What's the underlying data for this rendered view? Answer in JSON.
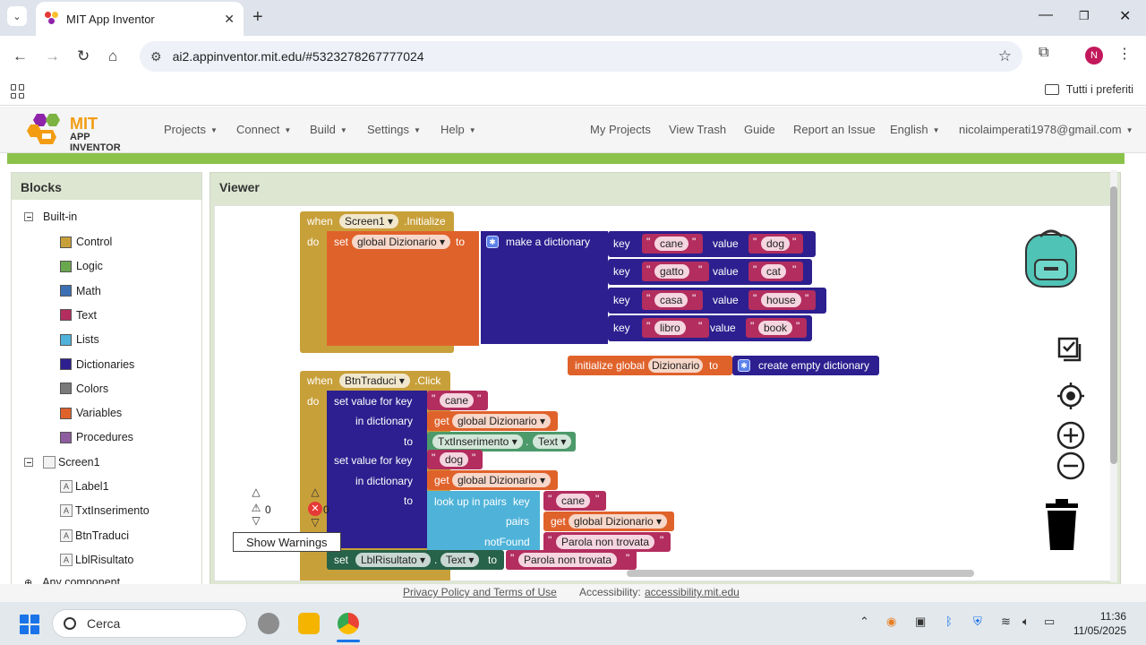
{
  "browser": {
    "tab_title": "MIT App Inventor",
    "url": "ai2.appinventor.mit.edu/#5323278267777024",
    "profile_initial": "N",
    "bookmarks_all_label": "Tutti i preferiti"
  },
  "app": {
    "logo_mit": "MIT",
    "logo_app_inventor": "APP INVENTOR",
    "menu": [
      "Projects",
      "Connect",
      "Build",
      "Settings",
      "Help"
    ],
    "right_links": [
      "My Projects",
      "View Trash",
      "Guide",
      "Report an Issue"
    ],
    "language": "English",
    "user_email": "nicolaimperati1978@gmail.com"
  },
  "blocks_panel": {
    "title": "Blocks",
    "builtin_label": "Built-in",
    "builtin_items": [
      {
        "label": "Control",
        "color": "#c8a03a"
      },
      {
        "label": "Logic",
        "color": "#6aa84f"
      },
      {
        "label": "Math",
        "color": "#3d6fb4"
      },
      {
        "label": "Text",
        "color": "#b32d5e"
      },
      {
        "label": "Lists",
        "color": "#4fb3d9"
      },
      {
        "label": "Dictionaries",
        "color": "#2d1f8f"
      },
      {
        "label": "Colors",
        "color": "#7a7a7a"
      },
      {
        "label": "Variables",
        "color": "#e0622b"
      },
      {
        "label": "Procedures",
        "color": "#8e5d9f"
      }
    ],
    "screen_label": "Screen1",
    "screen_items": [
      "Label1",
      "TxtInserimento",
      "BtnTraduci",
      "LblRisultato"
    ],
    "any_component_label": "Any component"
  },
  "viewer": {
    "title": "Viewer",
    "warning_count": "0",
    "error_count": "0",
    "show_warnings_label": "Show Warnings"
  },
  "blocks": {
    "init_event": {
      "when": "when",
      "component": "Screen1",
      "event": ".Initialize",
      "do": "do"
    },
    "set_global": {
      "set": "set",
      "var": "global Dizionario",
      "to": "to"
    },
    "make_dict": {
      "label": "make a dictionary",
      "pairs": [
        {
          "key_label": "key",
          "key": "cane",
          "value_label": "value",
          "value": "dog"
        },
        {
          "key_label": "key",
          "key": "gatto",
          "value_label": "value",
          "value": "cat"
        },
        {
          "key_label": "key",
          "key": "casa",
          "value_label": "value",
          "value": "house"
        },
        {
          "key_label": "key",
          "key": "libro",
          "value_label": "value",
          "value": "book"
        }
      ]
    },
    "init_global": {
      "label": "initialize global",
      "name": "Dizionario",
      "to": "to",
      "value": "create empty dictionary"
    },
    "click_event": {
      "when": "when",
      "component": "BtnTraduci",
      "event": ".Click",
      "do": "do"
    },
    "set_value_1": {
      "label": "set value for key",
      "key": "cane",
      "in_dict": "in dictionary",
      "get": "get",
      "dict": "global Dizionario",
      "to": "to",
      "comp": "TxtInserimento",
      "prop": "Text"
    },
    "set_value_2": {
      "label": "set value for key",
      "key": "dog",
      "in_dict": "in dictionary",
      "get": "get",
      "dict": "global Dizionario",
      "to": "to"
    },
    "lookup": {
      "label": "look up in pairs",
      "key_label": "key",
      "key": "cane",
      "pairs_label": "pairs",
      "get": "get",
      "dict": "global Dizionario",
      "notfound_label": "notFound",
      "notfound": "Parola non trovata"
    },
    "set_label": {
      "set": "set",
      "comp": "LblRisultato",
      "prop": "Text",
      "to": "to",
      "value": "Parola non trovata"
    }
  },
  "footer": {
    "privacy": "Privacy Policy and Terms of Use",
    "accessibility_label": "Accessibility:",
    "accessibility_link": "accessibility.mit.edu"
  },
  "taskbar": {
    "search_placeholder": "Cerca",
    "time": "11:36",
    "date": "11/05/2025"
  }
}
